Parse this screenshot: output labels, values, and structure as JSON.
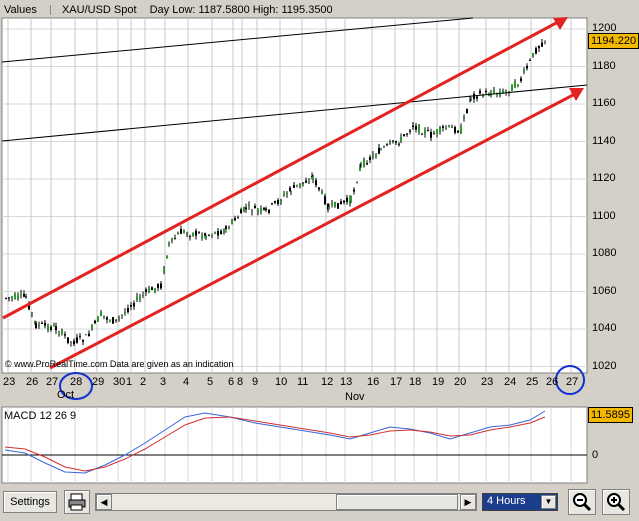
{
  "header": {
    "values_label": "Values",
    "symbol": "XAU/USD Spot",
    "day_range": "Day Low: 1187.5800 High: 1195.3500"
  },
  "price_axis": {
    "ticks": [
      "1200",
      "1180",
      "1160",
      "1140",
      "1120",
      "1100",
      "1080",
      "1060",
      "1040",
      "1020"
    ],
    "current_price": "1194.220"
  },
  "date_axis": {
    "ticks": [
      "23",
      "26",
      "27",
      "28",
      "29",
      "30",
      "1",
      "2",
      "3",
      "4",
      "5",
      "6",
      "8",
      "9",
      "10",
      "11",
      "12",
      "13",
      "16",
      "17",
      "18",
      "19",
      "20",
      "23",
      "24",
      "25",
      "26",
      "27"
    ],
    "month_labels": [
      "Oct",
      "Nov"
    ]
  },
  "watermark": "© www.ProRealTime.com Data are given as an indication",
  "macd": {
    "label": "MACD 12 26 9",
    "value": "11.5895",
    "zero_tick": "0"
  },
  "toolbar": {
    "settings_label": "Settings",
    "timeframe": "4 Hours"
  },
  "colors": {
    "channel": "#e32222",
    "up_candle": "#2a9a2a",
    "down_candle": "#000000",
    "macd_line": "#3a64d8",
    "signal_line": "#d03030",
    "highlight_circle": "#1030d0",
    "price_badge": "#f5b800"
  },
  "icons": [
    "print-icon",
    "zoom-out-icon",
    "zoom-in-icon",
    "scroll-left-icon",
    "scroll-right-icon",
    "dropdown-arrow-icon"
  ]
}
